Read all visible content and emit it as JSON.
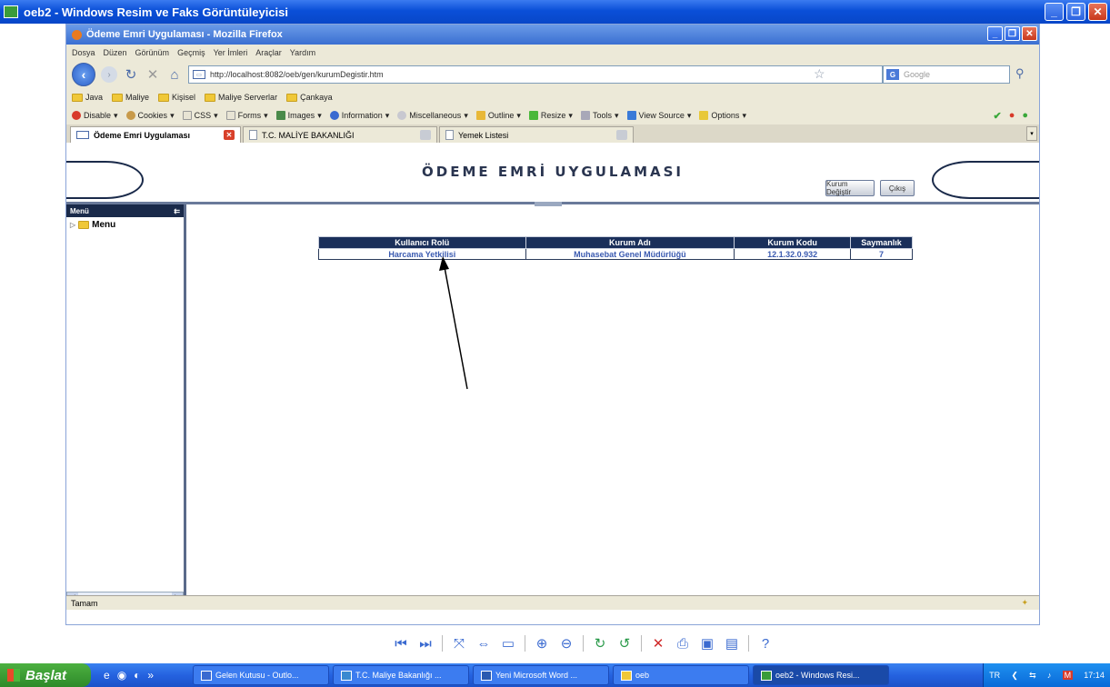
{
  "outer_window": {
    "title": "oeb2 - Windows Resim ve Faks Görüntüleyicisi"
  },
  "firefox": {
    "title": "Ödeme Emri Uygulaması - Mozilla Firefox",
    "menu": [
      "Dosya",
      "Düzen",
      "Görünüm",
      "Geçmiş",
      "Yer İmleri",
      "Araçlar",
      "Yardım"
    ],
    "url": "http://localhost:8082/oeb/gen/kurumDegistir.htm",
    "search_placeholder": "Google",
    "bookmarks": [
      "Java",
      "Maliye",
      "Kişisel",
      "Maliye Serverlar",
      "Çankaya"
    ],
    "dev_toolbar": [
      "Disable",
      "Cookies",
      "CSS",
      "Forms",
      "Images",
      "Information",
      "Miscellaneous",
      "Outline",
      "Resize",
      "Tools",
      "View Source",
      "Options"
    ],
    "tabs": [
      "Ödeme Emri Uygulaması",
      "T.C. MALİYE BAKANLIĞI",
      "Yemek Listesi"
    ],
    "status": "Tamam"
  },
  "app": {
    "title": "ÖDEME EMRİ UYGULAMASI",
    "buttons": {
      "change_org": "Kurum Değiştir",
      "logout": "Çıkış"
    },
    "sidebar": {
      "header": "Menü",
      "items": [
        "Menu"
      ]
    },
    "table": {
      "headers": [
        "Kullanıcı Rolü",
        "Kurum Adı",
        "Kurum Kodu",
        "Saymanlık"
      ],
      "rows": [
        [
          "Harcama Yetkilisi",
          "Muhasebat Genel Müdürlüğü",
          "12.1.32.0.932",
          "7"
        ]
      ]
    }
  },
  "taskbar": {
    "start": "Başlat",
    "items": [
      "Gelen Kutusu - Outlo...",
      "T.C. Maliye Bakanlığı ...",
      "Yeni Microsoft Word ...",
      "oeb",
      "oeb2 - Windows Resi..."
    ],
    "lang": "TR",
    "clock": "17:14"
  }
}
